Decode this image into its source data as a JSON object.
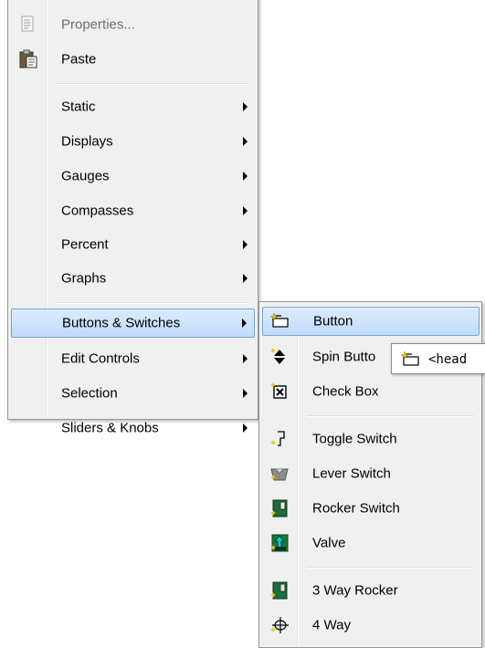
{
  "main_menu": {
    "items": [
      {
        "label": "Properties...",
        "icon": "properties-icon",
        "enabled": false
      },
      {
        "label": "Paste",
        "icon": "paste-icon",
        "enabled": true
      },
      {
        "label": "Static",
        "has_submenu": true
      },
      {
        "label": "Displays",
        "has_submenu": true
      },
      {
        "label": "Gauges",
        "has_submenu": true
      },
      {
        "label": "Compasses",
        "has_submenu": true
      },
      {
        "label": "Percent",
        "has_submenu": true
      },
      {
        "label": "Graphs",
        "has_submenu": true
      },
      {
        "label": "Buttons & Switches",
        "has_submenu": true,
        "highlighted": true
      },
      {
        "label": "Edit Controls",
        "has_submenu": true
      },
      {
        "label": "Selection",
        "has_submenu": true
      },
      {
        "label": "Sliders & Knobs",
        "has_submenu": true
      }
    ]
  },
  "sub_menu": {
    "items": [
      {
        "label": "Button",
        "icon": "button-icon",
        "highlighted": true
      },
      {
        "label": "Spin Butto",
        "icon": "spin-button-icon"
      },
      {
        "label": "Check Box",
        "icon": "check-box-icon"
      },
      {
        "label": "Toggle Switch",
        "icon": "toggle-switch-icon"
      },
      {
        "label": "Lever Switch",
        "icon": "lever-switch-icon"
      },
      {
        "label": "Rocker Switch",
        "icon": "rocker-switch-icon"
      },
      {
        "label": "Valve",
        "icon": "valve-icon"
      },
      {
        "label": "3 Way Rocker",
        "icon": "three-way-rocker-icon"
      },
      {
        "label": "4 Way",
        "icon": "four-way-icon"
      }
    ]
  },
  "tooltip": {
    "text": "<head",
    "icon": "button-icon"
  },
  "colors": {
    "menu_bg": "#f0f0f0",
    "highlight_top": "#dcebfc",
    "highlight_bottom": "#c1dbfc",
    "highlight_border": "#7da2ce",
    "disabled_text": "#6d6d6d"
  }
}
